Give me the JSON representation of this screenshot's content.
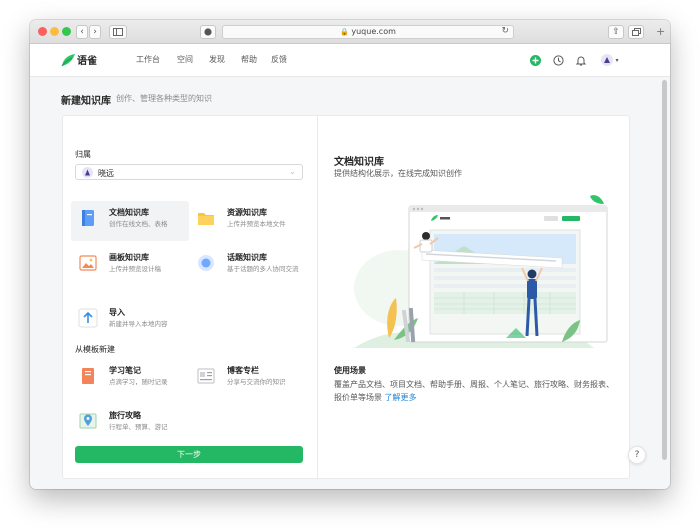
{
  "browser": {
    "url": "yuque.com",
    "plus": "+"
  },
  "header": {
    "brand": "语雀",
    "nav": [
      "工作台",
      "空间",
      "发现",
      "帮助",
      "反馈"
    ]
  },
  "page": {
    "title": "新建知识库",
    "subtitle": "创作、管理各种类型的知识"
  },
  "form": {
    "owner_label": "归属",
    "owner_value": "晓远",
    "section_template": "从模板新建",
    "next_label": "下一步"
  },
  "options": [
    {
      "title": "文档知识库",
      "desc": "创作在线文档、表格",
      "icon": "document-book-icon",
      "color": "#5b9df7"
    },
    {
      "title": "资源知识库",
      "desc": "上传并预览本地文件",
      "icon": "folder-icon",
      "color": "#f7c744"
    },
    {
      "title": "画板知识库",
      "desc": "上传并预览设计稿",
      "icon": "picture-board-icon",
      "color": "#f28a5b"
    },
    {
      "title": "话题知识库",
      "desc": "基于话题的多人协同交流",
      "icon": "topic-bubble-icon",
      "color": "#6fa8ff"
    },
    {
      "title": "导入",
      "desc": "新建并导入本地内容",
      "icon": "import-arrow-icon",
      "color": "#3a8de0"
    }
  ],
  "templates": [
    {
      "title": "学习笔记",
      "desc": "点滴学习，随时记录",
      "icon": "notebook-icon",
      "color": "#f3845a"
    },
    {
      "title": "博客专栏",
      "desc": "分享与交流你的知识",
      "icon": "blog-icon",
      "color": "#9aa0a6"
    },
    {
      "title": "旅行攻略",
      "desc": "行程单、预算、游记",
      "icon": "map-pin-icon",
      "color": "#4f9fd8"
    }
  ],
  "preview": {
    "title": "文档知识库",
    "desc": "提供结构化展示，在线完成知识创作",
    "scene_label": "使用场景",
    "scene_text": "覆盖产品文档、项目文档、帮助手册、周报、个人笔记、旅行攻略、财务报表、报价单等场景",
    "learn_more": "了解更多"
  },
  "help": "?",
  "colors": {
    "accent": "#25b864",
    "link": "#1f84d6"
  }
}
